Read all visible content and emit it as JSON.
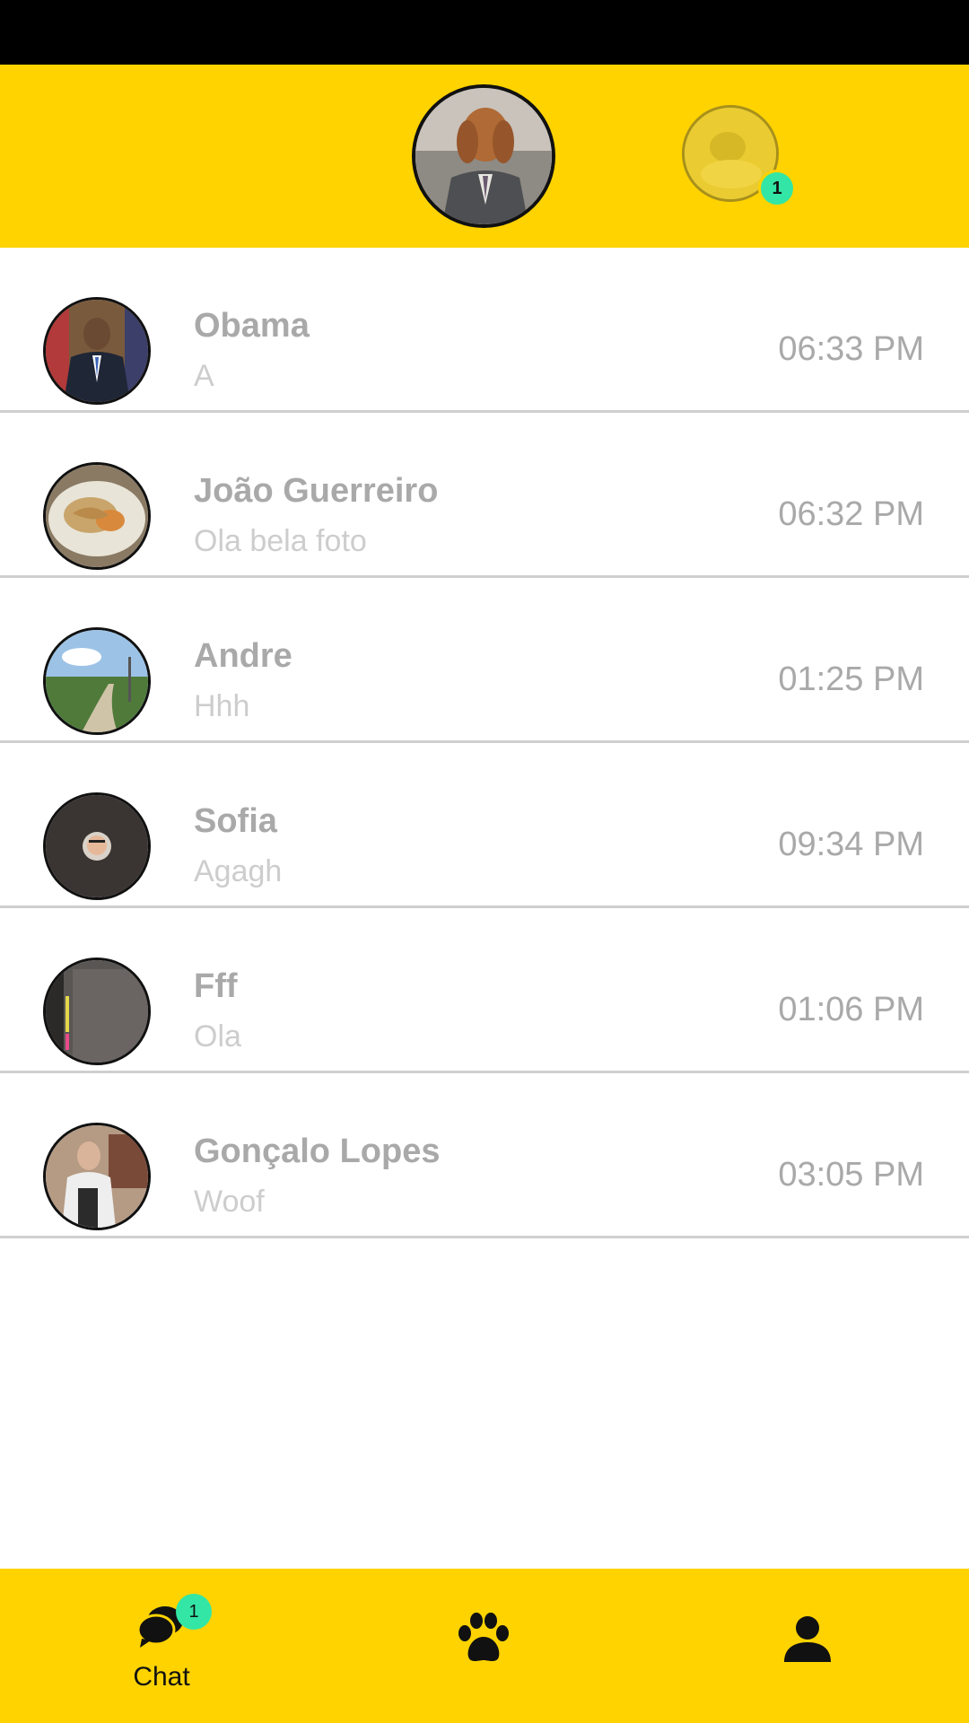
{
  "header": {
    "pet_badge_count": "1"
  },
  "chats": [
    {
      "name": "Obama",
      "message": "A",
      "time": "06:33 PM"
    },
    {
      "name": "João Guerreiro",
      "message": "Ola bela foto",
      "time": "06:32 PM"
    },
    {
      "name": "Andre",
      "message": "Hhh",
      "time": "01:25 PM"
    },
    {
      "name": "Sofia",
      "message": "Agagh",
      "time": "09:34 PM"
    },
    {
      "name": "Fff",
      "message": "Ola",
      "time": "01:06 PM"
    },
    {
      "name": "Gonçalo Lopes",
      "message": "Woof",
      "time": "03:05 PM"
    }
  ],
  "bottom_nav": {
    "chat_label": "Chat",
    "chat_badge": "1"
  },
  "colors": {
    "accent": "#FFD300",
    "badge": "#33E6A5",
    "status_bar": "#000000",
    "name_text": "#A9A9A9",
    "message_text": "#CDCDCD"
  },
  "icons": {
    "chat": "chat-bubbles-icon",
    "pets": "paw-icon",
    "profile": "person-icon"
  }
}
